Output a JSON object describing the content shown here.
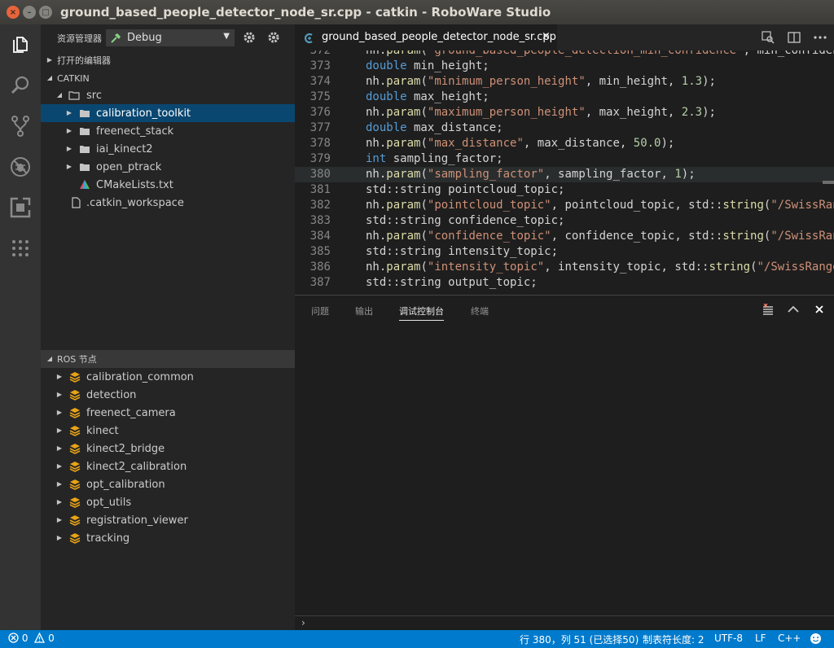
{
  "window": {
    "title": "ground_based_people_detector_node_sr.cpp - catkin - RoboWare Studio",
    "close_glyph": "×",
    "min_glyph": "–",
    "max_glyph": "□"
  },
  "activity_bar": {
    "items": [
      "explorer-icon",
      "search-icon",
      "source-control-icon",
      "debug-icon",
      "extensions-icon",
      "more-icon"
    ]
  },
  "sidebar": {
    "title": "资源管理器",
    "config": {
      "selected": "Debug",
      "caret": "▼"
    },
    "open_editors_label": "打开的编辑器",
    "workspace_label": "CATKIN",
    "files": [
      {
        "label": "src",
        "type": "folder-open",
        "expanded": true
      },
      {
        "label": "calibration_toolkit",
        "type": "folder",
        "selected": true
      },
      {
        "label": "freenect_stack",
        "type": "folder"
      },
      {
        "label": "iai_kinect2",
        "type": "folder"
      },
      {
        "label": "open_ptrack",
        "type": "folder"
      },
      {
        "label": "CMakeLists.txt",
        "type": "cmake"
      },
      {
        "label": ".catkin_workspace",
        "type": "file"
      }
    ],
    "ros_nodes_label": "ROS 节点",
    "ros_nodes": [
      "calibration_common",
      "detection",
      "freenect_camera",
      "kinect",
      "kinect2_bridge",
      "kinect2_calibration",
      "opt_calibration",
      "opt_utils",
      "registration_viewer",
      "tracking"
    ]
  },
  "tab": {
    "title": "ground_based_people_detector_node_sr.cpp",
    "close": "×"
  },
  "editor": {
    "lines": [
      {
        "n": "372",
        "code": [
          [
            "t",
            "nh."
          ],
          [
            "f",
            "param"
          ],
          [
            "t",
            "("
          ],
          [
            "s",
            "\"ground_based_people_detection_min_confidence\""
          ],
          [
            "t",
            ", min_confidence"
          ]
        ]
      },
      {
        "n": "373",
        "code": [
          [
            "k",
            "double"
          ],
          [
            "t",
            " min_height;"
          ]
        ]
      },
      {
        "n": "374",
        "code": [
          [
            "t",
            "nh."
          ],
          [
            "f",
            "param"
          ],
          [
            "t",
            "("
          ],
          [
            "s",
            "\"minimum_person_height\""
          ],
          [
            "t",
            ", min_height, "
          ],
          [
            "n",
            "1.3"
          ],
          [
            "t",
            ");"
          ]
        ]
      },
      {
        "n": "375",
        "code": [
          [
            "k",
            "double"
          ],
          [
            "t",
            " max_height;"
          ]
        ]
      },
      {
        "n": "376",
        "code": [
          [
            "t",
            "nh."
          ],
          [
            "f",
            "param"
          ],
          [
            "t",
            "("
          ],
          [
            "s",
            "\"maximum_person_height\""
          ],
          [
            "t",
            ", max_height, "
          ],
          [
            "n",
            "2.3"
          ],
          [
            "t",
            ");"
          ]
        ]
      },
      {
        "n": "377",
        "code": [
          [
            "k",
            "double"
          ],
          [
            "t",
            " max_distance;"
          ]
        ]
      },
      {
        "n": "378",
        "code": [
          [
            "t",
            "nh."
          ],
          [
            "f",
            "param"
          ],
          [
            "t",
            "("
          ],
          [
            "s",
            "\"max_distance\""
          ],
          [
            "t",
            ", max_distance, "
          ],
          [
            "n",
            "50.0"
          ],
          [
            "t",
            ");"
          ]
        ]
      },
      {
        "n": "379",
        "code": [
          [
            "k",
            "int"
          ],
          [
            "t",
            " sampling_factor;"
          ]
        ]
      },
      {
        "n": "380",
        "code": [
          [
            "t",
            "nh."
          ],
          [
            "f",
            "param"
          ],
          [
            "t",
            "("
          ],
          [
            "s",
            "\"sampling_factor\""
          ],
          [
            "t",
            ", sampling_factor, "
          ],
          [
            "n",
            "1"
          ],
          [
            "t",
            ");"
          ]
        ],
        "highlight": true
      },
      {
        "n": "381",
        "code": [
          [
            "t",
            "std::string pointcloud_topic;"
          ]
        ]
      },
      {
        "n": "382",
        "code": [
          [
            "t",
            "nh."
          ],
          [
            "f",
            "param"
          ],
          [
            "t",
            "("
          ],
          [
            "s",
            "\"pointcloud_topic\""
          ],
          [
            "t",
            ", pointcloud_topic, std::"
          ],
          [
            "f",
            "string"
          ],
          [
            "t",
            "("
          ],
          [
            "s",
            "\"/SwissRanger"
          ]
        ]
      },
      {
        "n": "383",
        "code": [
          [
            "t",
            "std::string confidence_topic;"
          ]
        ]
      },
      {
        "n": "384",
        "code": [
          [
            "t",
            "nh."
          ],
          [
            "f",
            "param"
          ],
          [
            "t",
            "("
          ],
          [
            "s",
            "\"confidence_topic\""
          ],
          [
            "t",
            ", confidence_topic, std::"
          ],
          [
            "f",
            "string"
          ],
          [
            "t",
            "("
          ],
          [
            "s",
            "\"/SwissRanger"
          ]
        ]
      },
      {
        "n": "385",
        "code": [
          [
            "t",
            "std::string intensity_topic;"
          ]
        ]
      },
      {
        "n": "386",
        "code": [
          [
            "t",
            "nh."
          ],
          [
            "f",
            "param"
          ],
          [
            "t",
            "("
          ],
          [
            "s",
            "\"intensity_topic\""
          ],
          [
            "t",
            ", intensity_topic, std::"
          ],
          [
            "f",
            "string"
          ],
          [
            "t",
            "("
          ],
          [
            "s",
            "\"/SwissRanger"
          ]
        ]
      },
      {
        "n": "387",
        "code": [
          [
            "t",
            "std::string output_topic;"
          ]
        ]
      }
    ]
  },
  "panel": {
    "tabs": [
      "问题",
      "输出",
      "调试控制台",
      "终端"
    ],
    "active_tab": "调试控制台",
    "prompt": "›"
  },
  "status": {
    "errors": "0",
    "warnings": "0",
    "position": "行 380，列 51 (已选择50)",
    "indent": "制表符长度: 2",
    "encoding": "UTF-8",
    "eol": "LF",
    "language": "C++"
  },
  "colors": {
    "accent": "#007acc",
    "selection": "#094771",
    "ros_icon": "#e8a317"
  }
}
